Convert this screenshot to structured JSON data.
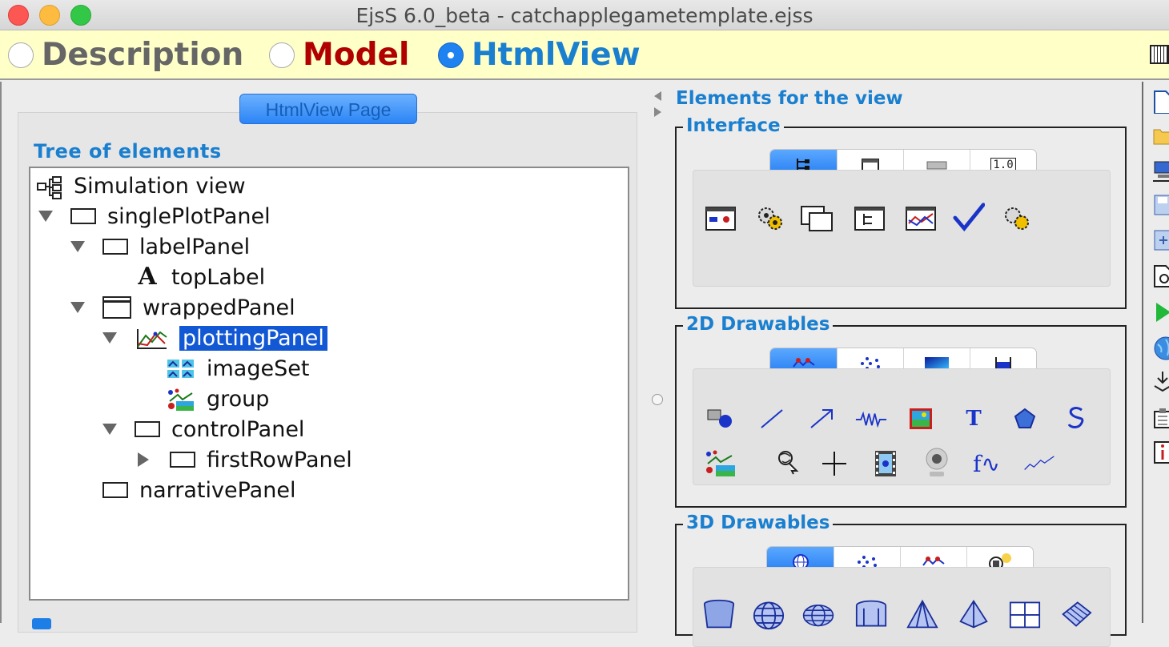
{
  "window": {
    "title": "EjsS 6.0_beta - catchapplegametemplate.ejss"
  },
  "modes": [
    {
      "label": "Description",
      "selected": false
    },
    {
      "label": "Model",
      "selected": false
    },
    {
      "label": "HtmlView",
      "selected": true
    }
  ],
  "left": {
    "page_tab": "HtmlView Page",
    "section_title": "Tree of elements",
    "tree": [
      {
        "label": "Simulation view",
        "depth": 0,
        "icon": "hierarchy-icon",
        "expander": "none"
      },
      {
        "label": "singlePlotPanel",
        "depth": 0,
        "icon": "panel-icon",
        "expander": "expanded"
      },
      {
        "label": "labelPanel",
        "depth": 1,
        "icon": "panel-icon",
        "expander": "expanded"
      },
      {
        "label": "topLabel",
        "depth": 2,
        "icon": "label-icon",
        "expander": "none"
      },
      {
        "label": "wrappedPanel",
        "depth": 1,
        "icon": "wrapped-panel-icon",
        "expander": "expanded"
      },
      {
        "label": "plottingPanel",
        "depth": 2,
        "icon": "plotting-panel-icon",
        "expander": "expanded",
        "selected": true
      },
      {
        "label": "imageSet",
        "depth": 3,
        "icon": "image-set-icon",
        "expander": "none"
      },
      {
        "label": "group",
        "depth": 3,
        "icon": "group-icon",
        "expander": "none"
      },
      {
        "label": "controlPanel",
        "depth": 2,
        "icon": "panel-icon",
        "expander": "expanded"
      },
      {
        "label": "firstRowPanel",
        "depth": 3,
        "icon": "panel-icon",
        "expander": "collapsed"
      },
      {
        "label": "narrativePanel",
        "depth": 1,
        "icon": "panel-icon",
        "expander": "none"
      }
    ]
  },
  "right": {
    "title": "Elements for the view",
    "groups": [
      {
        "label": "Interface",
        "tabs": [
          "tree-icon",
          "window-icon",
          "bar-icon",
          "number-field-icon"
        ],
        "tab_number_text": "1.0",
        "active_tab": 0,
        "icons": [
          "panel-with-data-icon",
          "gears-icon",
          "stacked-windows-icon",
          "tree-panel-icon",
          "plot-panel-icon",
          "checkmark-icon",
          "gears-small-icon"
        ]
      },
      {
        "label": "2D Drawables",
        "tabs": [
          "trace-icon",
          "points-icon",
          "gradient-icon",
          "container-icon"
        ],
        "active_tab": 0,
        "icons": [
          "shape-icon",
          "segment-icon",
          "arrow-icon",
          "spring-icon",
          "image-icon",
          "text-icon",
          "polygon-icon",
          "trail-icon",
          "group-2d-icon",
          "cursor-icon",
          "crosshair-icon",
          "video-icon",
          "webcam-icon",
          "function-icon",
          "trace-line-icon"
        ],
        "text_icon_glyph": "T",
        "function_icon_glyph": "f∿"
      },
      {
        "label": "3D Drawables",
        "tabs": [
          "sphere-icon",
          "points-3d-icon",
          "trace-3d-icon",
          "camera-icon"
        ],
        "active_tab": 0,
        "icons": [
          "cylinder-icon",
          "globe-icon",
          "ellipsoid-icon",
          "tank-icon",
          "cone-icon",
          "pyramid-icon",
          "grid-icon",
          "surface-icon"
        ]
      }
    ]
  },
  "colors": {
    "accent_blue": "#1a7fcf",
    "model_red": "#b00000",
    "mode_bar_bg": "#ffffc8",
    "selection_bg": "#1258d4"
  }
}
